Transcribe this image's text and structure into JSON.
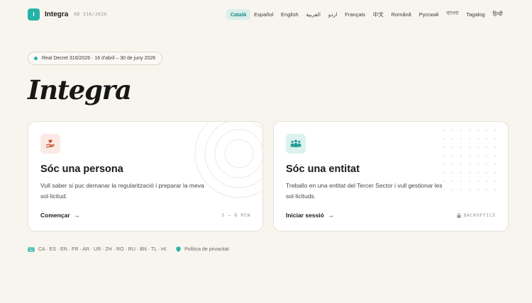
{
  "header": {
    "logo_letter": "I",
    "brand": "Integra",
    "brand_sub": "RD 316/2026",
    "languages": [
      {
        "label": "Català",
        "active": true
      },
      {
        "label": "Español"
      },
      {
        "label": "English"
      },
      {
        "label": "العربية"
      },
      {
        "label": "اردو"
      },
      {
        "label": "Français"
      },
      {
        "label": "中文"
      },
      {
        "label": "Română"
      },
      {
        "label": "Русский"
      },
      {
        "label": "বাংলা"
      },
      {
        "label": "Tagalog"
      },
      {
        "label": "हिन्दी"
      }
    ]
  },
  "hero": {
    "pill_text": "Real Decret 316/2026 · 16 d'abril – 30 de juny 2026",
    "title": "Integra"
  },
  "cards": {
    "person": {
      "icon": "hand-heart-icon",
      "title": "Sóc una persona",
      "description": "Vull saber si puc demanar la regularització i preparar la meva sol·licitud.",
      "cta": "Començar",
      "meta": "5 – 8 MIN"
    },
    "entity": {
      "icon": "group-people-icon",
      "title": "Sóc una entitat",
      "description": "Treballo en una entitat del Tercer Sector i vull gestionar les sol·licituds.",
      "cta": "Iniciar sessió",
      "meta": "BACKOFFICE"
    }
  },
  "footer": {
    "languages_text": "CA · ES · EN · FR · AR · UR · ZH · RO · RU · BN · TL · HI",
    "privacy": "Política de privacitat"
  },
  "colors": {
    "background": "#f8f5ef",
    "accent": "#25b3a6",
    "person_accent": "#c9563a"
  }
}
